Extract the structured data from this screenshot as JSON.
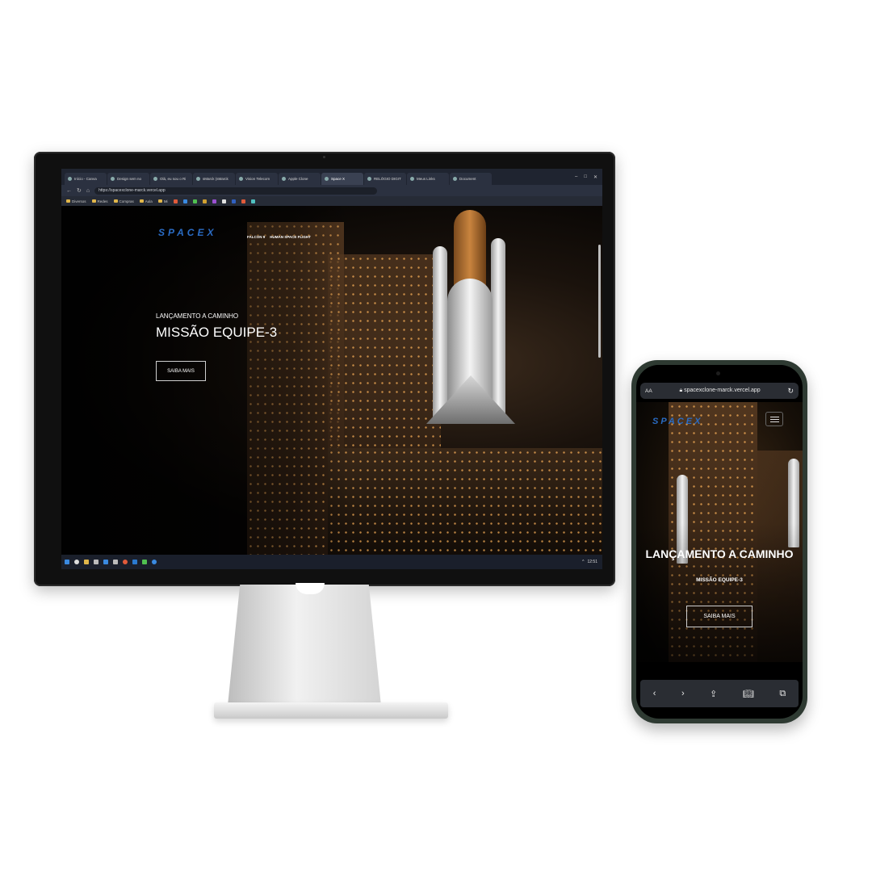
{
  "browser": {
    "tabs": [
      {
        "label": "Início - Canva",
        "active": false
      },
      {
        "label": "Design sem no",
        "active": false
      },
      {
        "label": "Olá, eu sou o Ri",
        "active": false
      },
      {
        "label": "sMarck (sMarck",
        "active": false
      },
      {
        "label": "Vision Telecom",
        "active": false
      },
      {
        "label": "Apple Clone",
        "active": false
      },
      {
        "label": "Space X",
        "active": true
      },
      {
        "label": "RELÓGIO DIGIT",
        "active": false
      },
      {
        "label": "Meus Links",
        "active": false
      },
      {
        "label": "Document",
        "active": false
      }
    ],
    "url": "https://spacexclone-marck.vercel.app",
    "bookmarks": [
      "Diversos",
      "Redes",
      "Compras",
      "Aula",
      "Mi"
    ]
  },
  "site": {
    "logo": "SPACEX",
    "nav": [
      "FALCON 9",
      "HUMAN SPACE FLIGHT"
    ],
    "kicker": "LANÇAMENTO A CAMINHO",
    "title": "MISSÃO EQUIPE-3",
    "cta": "SAIBA MAIS"
  },
  "taskbar": {
    "time": "12:51"
  },
  "phone": {
    "aa": "AA",
    "url": "spacexclone-marck.vercel.app",
    "logo": "SPACEX",
    "title": "LANÇAMENTO A CAMINHO",
    "subtitle": "MISSÃO EQUIPE-3",
    "cta": "SAIBA MAIS"
  },
  "colors": {
    "brand_blue": "#2a6cc4",
    "phone_frame": "#2e3a32",
    "tab_bar": "#1f2430"
  },
  "icons": [
    "back-icon",
    "forward-icon",
    "share-icon",
    "bookmarks-icon",
    "tabs-icon",
    "reload-icon",
    "lock-icon",
    "menu-icon"
  ]
}
